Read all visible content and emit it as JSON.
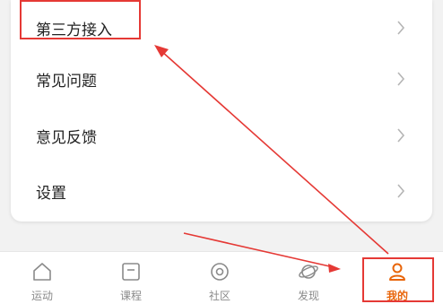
{
  "menu": {
    "items": [
      {
        "label": "第三方接入"
      },
      {
        "label": "常见问题"
      },
      {
        "label": "意见反馈"
      },
      {
        "label": "设置"
      }
    ]
  },
  "tabbar": {
    "tabs": [
      {
        "label": "运动",
        "icon": "home-icon",
        "active": false
      },
      {
        "label": "课程",
        "icon": "course-icon",
        "active": false
      },
      {
        "label": "社区",
        "icon": "community-icon",
        "active": false
      },
      {
        "label": "发现",
        "icon": "planet-icon",
        "active": false
      },
      {
        "label": "我的",
        "icon": "person-icon",
        "active": true
      }
    ]
  },
  "colors": {
    "accent": "#e8650a",
    "annotation": "#e53935"
  }
}
